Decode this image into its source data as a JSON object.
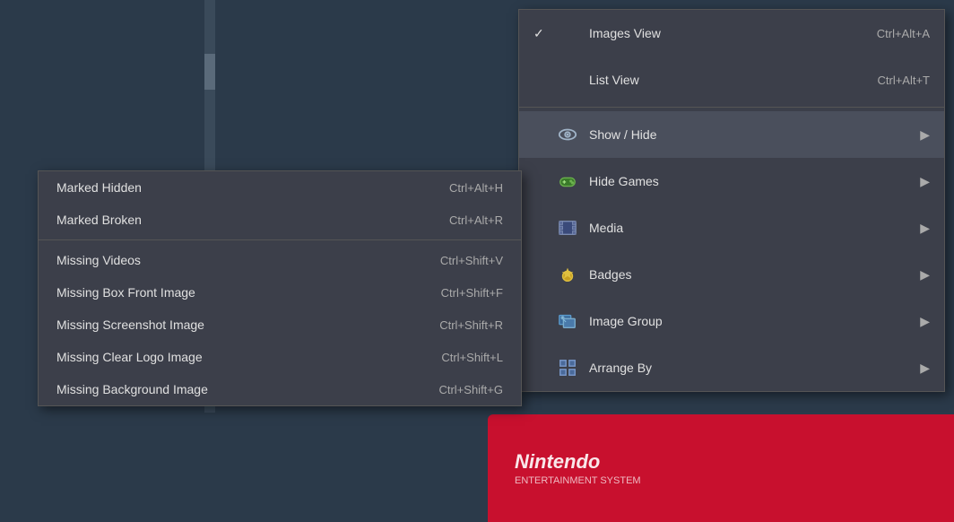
{
  "background": {
    "color": "#2b3a4a"
  },
  "nintendo_area": {
    "text": "Nintendo",
    "subtext": "ENTERTAINMENT SYSTEM"
  },
  "main_menu": {
    "items": [
      {
        "id": "images-view",
        "check": "✓",
        "icon": null,
        "label": "Images View",
        "shortcut": "Ctrl+Alt+A",
        "has_arrow": false
      },
      {
        "id": "list-view",
        "check": "",
        "icon": null,
        "label": "List View",
        "shortcut": "Ctrl+Alt+T",
        "has_arrow": false
      },
      {
        "id": "show-hide",
        "check": "",
        "icon": "eye",
        "label": "Show / Hide",
        "shortcut": "",
        "has_arrow": true,
        "active": true
      },
      {
        "id": "hide-games",
        "check": "",
        "icon": "hide-games",
        "label": "Hide Games",
        "shortcut": "",
        "has_arrow": true
      },
      {
        "id": "media",
        "check": "",
        "icon": "media",
        "label": "Media",
        "shortcut": "",
        "has_arrow": true
      },
      {
        "id": "badges",
        "check": "",
        "icon": "badges",
        "label": "Badges",
        "shortcut": "",
        "has_arrow": true
      },
      {
        "id": "image-group",
        "check": "",
        "icon": "image-group",
        "label": "Image Group",
        "shortcut": "",
        "has_arrow": true
      },
      {
        "id": "arrange-by",
        "check": "",
        "icon": "arrange",
        "label": "Arrange By",
        "shortcut": "",
        "has_arrow": true
      }
    ]
  },
  "submenu": {
    "items": [
      {
        "id": "marked-hidden",
        "label": "Marked Hidden",
        "shortcut": "Ctrl+Alt+H"
      },
      {
        "id": "marked-broken",
        "label": "Marked Broken",
        "shortcut": "Ctrl+Alt+R"
      },
      {
        "id": "missing-videos",
        "label": "Missing Videos",
        "shortcut": "Ctrl+Shift+V"
      },
      {
        "id": "missing-box-front",
        "label": "Missing Box Front Image",
        "shortcut": "Ctrl+Shift+F"
      },
      {
        "id": "missing-screenshot",
        "label": "Missing Screenshot Image",
        "shortcut": "Ctrl+Shift+R"
      },
      {
        "id": "missing-clear-logo",
        "label": "Missing Clear Logo Image",
        "shortcut": "Ctrl+Shift+L"
      },
      {
        "id": "missing-background",
        "label": "Missing Background Image",
        "shortcut": "Ctrl+Shift+G"
      }
    ]
  }
}
